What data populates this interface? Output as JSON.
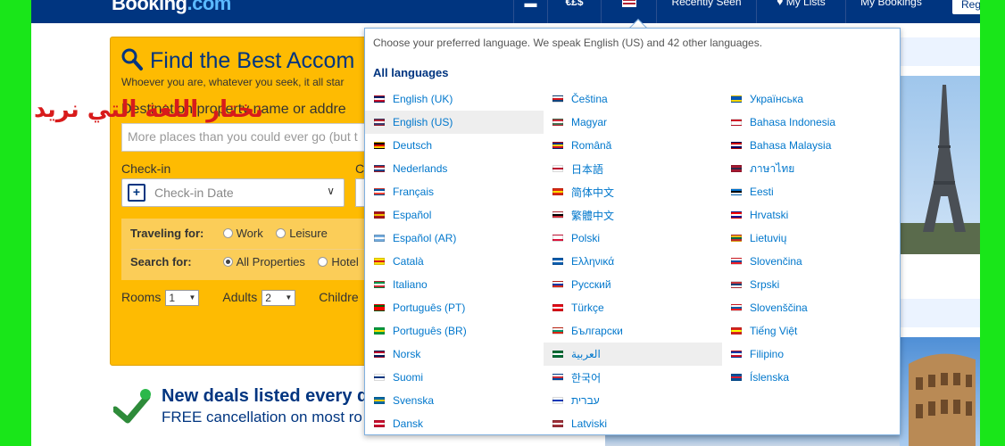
{
  "header": {
    "logo_main": "Booking",
    "logo_dot": ".com",
    "currency": "€£$",
    "recently_seen": "Recently Seen",
    "my_lists": "My Lists",
    "my_bookings": "My Bookings",
    "register": "Reg"
  },
  "search": {
    "title": "Find the Best Accom",
    "subtitle": "Whoever you are, whatever you seek, it all star",
    "destination_label": "Destination/property name or addre",
    "destination_placeholder": "More places than you could ever go (but t",
    "checkin_label": "Check-in",
    "checkout_label": "C",
    "checkin_placeholder": "Check-in Date",
    "traveling_for_label": "Traveling for:",
    "work": "Work",
    "leisure": "Leisure",
    "search_for_label": "Search for:",
    "all_properties": "All Properties",
    "hotels": "Hotel",
    "rooms_label": "Rooms",
    "rooms_value": "1",
    "adults_label": "Adults",
    "adults_value": "2",
    "children_label": "Childre"
  },
  "annotation": {
    "arabic_note": "نختار اللغة التي نريد"
  },
  "deals": {
    "title": "New deals listed every da",
    "subtitle": "FREE cancellation on most ro"
  },
  "language_menu": {
    "intro": "Choose your preferred language. We speak English (US) and 42 other languages.",
    "heading": "All languages",
    "columns": [
      [
        {
          "label": "English (UK)",
          "flag": [
            "#012169",
            "#ffffff",
            "#c8102e"
          ]
        },
        {
          "label": "English (US)",
          "flag": [
            "#b22234",
            "#ffffff",
            "#3c3b6e"
          ],
          "active": true
        },
        {
          "label": "Deutsch",
          "flag": [
            "#000000",
            "#dd0000",
            "#ffce00"
          ]
        },
        {
          "label": "Nederlands",
          "flag": [
            "#ae1c28",
            "#ffffff",
            "#21468b"
          ]
        },
        {
          "label": "Français",
          "flag": [
            "#0055a4",
            "#ffffff",
            "#ef4135"
          ]
        },
        {
          "label": "Español",
          "flag": [
            "#aa151b",
            "#f1bf00",
            "#aa151b"
          ]
        },
        {
          "label": "Español (AR)",
          "flag": [
            "#74acdf",
            "#ffffff",
            "#74acdf"
          ]
        },
        {
          "label": "Català",
          "flag": [
            "#fcdd09",
            "#da121a",
            "#fcdd09"
          ]
        },
        {
          "label": "Italiano",
          "flag": [
            "#009246",
            "#ffffff",
            "#ce2b37"
          ]
        },
        {
          "label": "Português (PT)",
          "flag": [
            "#006600",
            "#ff0000",
            "#ff0000"
          ]
        },
        {
          "label": "Português (BR)",
          "flag": [
            "#009c3b",
            "#ffdf00",
            "#009c3b"
          ]
        },
        {
          "label": "Norsk",
          "flag": [
            "#ba0c2f",
            "#ffffff",
            "#00205b"
          ]
        },
        {
          "label": "Suomi",
          "flag": [
            "#ffffff",
            "#003580",
            "#ffffff"
          ]
        },
        {
          "label": "Svenska",
          "flag": [
            "#006aa7",
            "#fecc00",
            "#006aa7"
          ]
        },
        {
          "label": "Dansk",
          "flag": [
            "#c8102e",
            "#ffffff",
            "#c8102e"
          ]
        }
      ],
      [
        {
          "label": "Čeština",
          "flag": [
            "#ffffff",
            "#d7141a",
            "#11457e"
          ]
        },
        {
          "label": "Magyar",
          "flag": [
            "#ce2939",
            "#ffffff",
            "#477050"
          ]
        },
        {
          "label": "Română",
          "flag": [
            "#002b7f",
            "#fcd116",
            "#ce1126"
          ]
        },
        {
          "label": "日本語",
          "flag": [
            "#ffffff",
            "#bc002d",
            "#ffffff"
          ]
        },
        {
          "label": "简体中文",
          "flag": [
            "#de2910",
            "#ffde00",
            "#de2910"
          ]
        },
        {
          "label": "繁體中文",
          "flag": [
            "#ffffff",
            "#000000",
            "#cd2e3a"
          ]
        },
        {
          "label": "Polski",
          "flag": [
            "#ffffff",
            "#ffffff",
            "#dc143c"
          ]
        },
        {
          "label": "Ελληνικά",
          "flag": [
            "#0d5eaf",
            "#ffffff",
            "#0d5eaf"
          ]
        },
        {
          "label": "Русский",
          "flag": [
            "#ffffff",
            "#0039a6",
            "#d52b1e"
          ]
        },
        {
          "label": "Türkçe",
          "flag": [
            "#e30a17",
            "#ffffff",
            "#e30a17"
          ]
        },
        {
          "label": "Български",
          "flag": [
            "#ffffff",
            "#00966e",
            "#d62612"
          ]
        },
        {
          "label": "العربية",
          "flag": [
            "#006c35",
            "#ffffff",
            "#006c35"
          ],
          "active": true
        },
        {
          "label": "한국어",
          "flag": [
            "#ffffff",
            "#cd2e3a",
            "#0047a0"
          ]
        },
        {
          "label": "עברית",
          "flag": [
            "#ffffff",
            "#0038b8",
            "#ffffff"
          ]
        },
        {
          "label": "Latviski",
          "flag": [
            "#9e3039",
            "#ffffff",
            "#9e3039"
          ]
        }
      ],
      [
        {
          "label": "Українська",
          "flag": [
            "#0057b7",
            "#0057b7",
            "#ffd700"
          ]
        },
        {
          "label": "Bahasa Indonesia",
          "flag": [
            "#ce1126",
            "#ffffff",
            "#ffffff"
          ]
        },
        {
          "label": "Bahasa Malaysia",
          "flag": [
            "#cc0001",
            "#ffffff",
            "#010066"
          ]
        },
        {
          "label": "ภาษาไทย",
          "flag": [
            "#a51931",
            "#2d2a4a",
            "#a51931"
          ]
        },
        {
          "label": "Eesti",
          "flag": [
            "#0072ce",
            "#000000",
            "#ffffff"
          ]
        },
        {
          "label": "Hrvatski",
          "flag": [
            "#ff0000",
            "#ffffff",
            "#171796"
          ]
        },
        {
          "label": "Lietuvių",
          "flag": [
            "#fdb913",
            "#006a44",
            "#c1272d"
          ]
        },
        {
          "label": "Slovenčina",
          "flag": [
            "#ffffff",
            "#0b4ea2",
            "#ee1c25"
          ]
        },
        {
          "label": "Srpski",
          "flag": [
            "#c6363c",
            "#0c4076",
            "#ffffff"
          ]
        },
        {
          "label": "Slovenščina",
          "flag": [
            "#ffffff",
            "#005da4",
            "#ed1c24"
          ]
        },
        {
          "label": "Tiếng Việt",
          "flag": [
            "#da251d",
            "#ffff00",
            "#da251d"
          ]
        },
        {
          "label": "Filipino",
          "flag": [
            "#0038a8",
            "#ffffff",
            "#ce1126"
          ]
        },
        {
          "label": "Íslenska",
          "flag": [
            "#02529c",
            "#dc1e35",
            "#02529c"
          ]
        }
      ]
    ]
  }
}
